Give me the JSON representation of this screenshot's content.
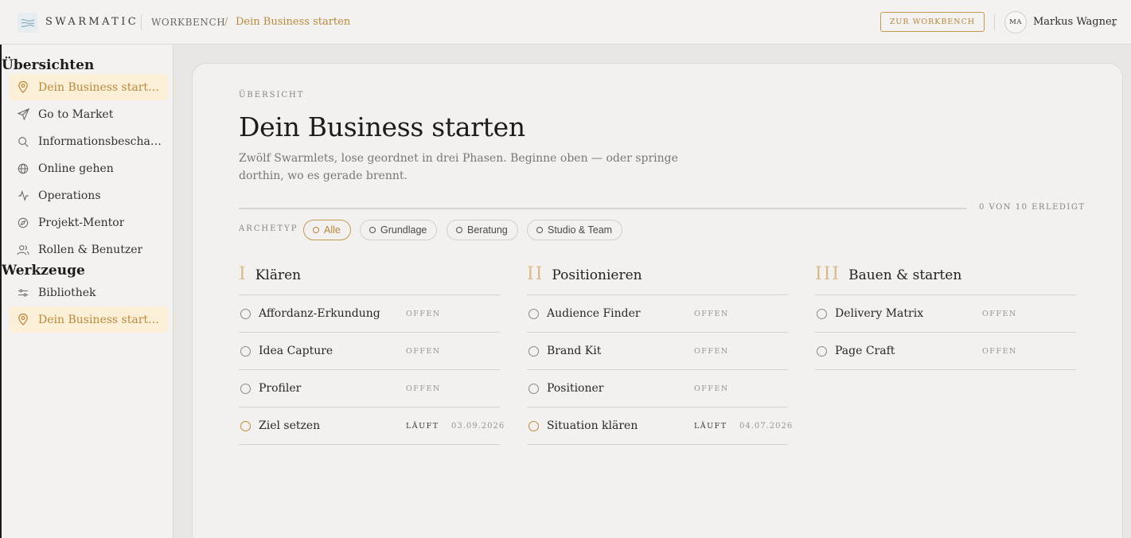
{
  "header": {
    "brand": "SWARMATIC",
    "breadcrumb_root": "WORKBENCH",
    "breadcrumb_separator": "/",
    "breadcrumb_current": "Dein Business starten",
    "workbench_button": "ZUR WORKBENCH",
    "user_initials": "MA",
    "user_name": "Markus Wagner"
  },
  "sidebar": {
    "sections": [
      {
        "title": "Übersichten",
        "items": [
          {
            "label": "Dein Business starten",
            "icon": "map-pin-icon",
            "active": true
          },
          {
            "label": "Go to Market",
            "icon": "send-icon",
            "active": false
          },
          {
            "label": "Informationsbeschaffung",
            "icon": "search-icon",
            "active": false
          },
          {
            "label": "Online gehen",
            "icon": "globe-icon",
            "active": false
          },
          {
            "label": "Operations",
            "icon": "activity-icon",
            "active": false
          },
          {
            "label": "Projekt-Mentor",
            "icon": "compass-icon",
            "active": false
          },
          {
            "label": "Rollen & Benutzer",
            "icon": "users-icon",
            "active": false
          }
        ]
      },
      {
        "title": "Werkzeuge",
        "items": [
          {
            "label": "Bibliothek",
            "icon": "sliders-icon",
            "active": false
          },
          {
            "label": "Dein Business starten",
            "icon": "map-pin-icon",
            "active": true
          }
        ]
      }
    ]
  },
  "main": {
    "eyebrow": "ÜBERSICHT",
    "title": "Dein Business starten",
    "description": "Zwölf Swarmlets, lose geordnet in drei Phasen. Beginne oben — oder springe dorthin, wo es gerade brennt.",
    "progress_label": "0 VON 10 ERLEDIGT",
    "archetype_label": "ARCHETYP",
    "filters": [
      {
        "label": "Alle",
        "active": true
      },
      {
        "label": "Grundlage",
        "active": false
      },
      {
        "label": "Beratung",
        "active": false
      },
      {
        "label": "Studio & Team",
        "active": false
      }
    ],
    "phases": [
      {
        "numeral": "I",
        "name": "Klären",
        "items": [
          {
            "name": "Affordanz-Erkundung",
            "status": "OFFEN",
            "date": ""
          },
          {
            "name": "Idea Capture",
            "status": "OFFEN",
            "date": ""
          },
          {
            "name": "Profiler",
            "status": "OFFEN",
            "date": ""
          },
          {
            "name": "Ziel setzen",
            "status": "LÄUFT",
            "date": "03.09.2026"
          }
        ]
      },
      {
        "numeral": "II",
        "name": "Positionieren",
        "items": [
          {
            "name": "Audience Finder",
            "status": "OFFEN",
            "date": ""
          },
          {
            "name": "Brand Kit",
            "status": "OFFEN",
            "date": ""
          },
          {
            "name": "Positioner",
            "status": "OFFEN",
            "date": ""
          },
          {
            "name": "Situation klären",
            "status": "LÄUFT",
            "date": "04.07.2026"
          }
        ]
      },
      {
        "numeral": "III",
        "name": "Bauen & starten",
        "items": [
          {
            "name": "Delivery Matrix",
            "status": "OFFEN",
            "date": ""
          },
          {
            "name": "Page Craft",
            "status": "OFFEN",
            "date": ""
          }
        ]
      }
    ]
  },
  "colors": {
    "accent": "#b8863a",
    "active_bg": "#fcefd8",
    "background": "#e9e7e5",
    "surface": "#f2f1f0"
  }
}
